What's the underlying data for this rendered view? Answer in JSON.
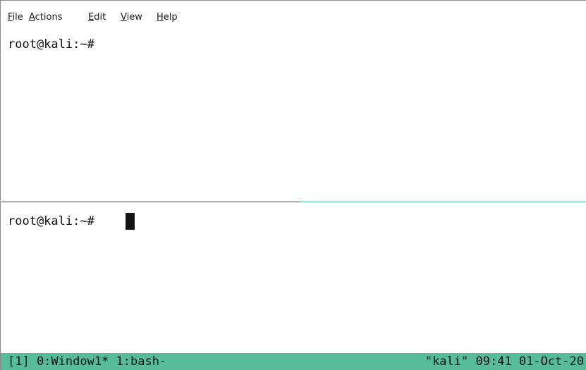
{
  "menu": {
    "items": [
      {
        "mnemonic": "F",
        "rest": "ile"
      },
      {
        "mnemonic": "A",
        "rest": "ctions"
      },
      {
        "mnemonic": "E",
        "rest": "dit"
      },
      {
        "mnemonic": "V",
        "rest": "iew"
      },
      {
        "mnemonic": "H",
        "rest": "elp"
      }
    ]
  },
  "panes": {
    "top": {
      "prompt": "root@kali:~#"
    },
    "bottom": {
      "prompt": "root@kali:~#"
    }
  },
  "status": {
    "left": "[1] 0:Window1* 1:bash-",
    "right": "\"kali\" 09:41 01-Oct-20"
  },
  "colors": {
    "status_bg": "#56bc9c",
    "active_divider": "#5cc8a8"
  }
}
